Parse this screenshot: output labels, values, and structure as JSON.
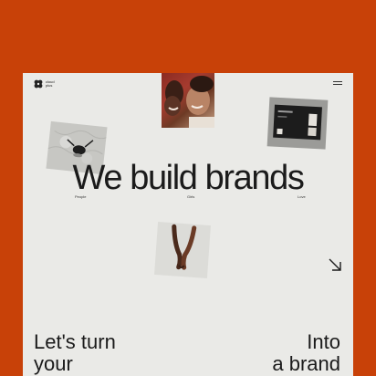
{
  "brand": {
    "logo_text": "cloud\nplus"
  },
  "hero": {
    "headline": "We build brands",
    "tags": [
      "People",
      "Girls",
      "Love"
    ]
  },
  "cta": {
    "left": "Let's turn\nyour",
    "right": "Into\na brand"
  },
  "colors": {
    "background": "#C84108",
    "panel": "#EAEAE7",
    "text": "#1B1B1B"
  },
  "icons": {
    "menu": "hamburger-icon",
    "arrow": "arrow-down-right-icon"
  }
}
